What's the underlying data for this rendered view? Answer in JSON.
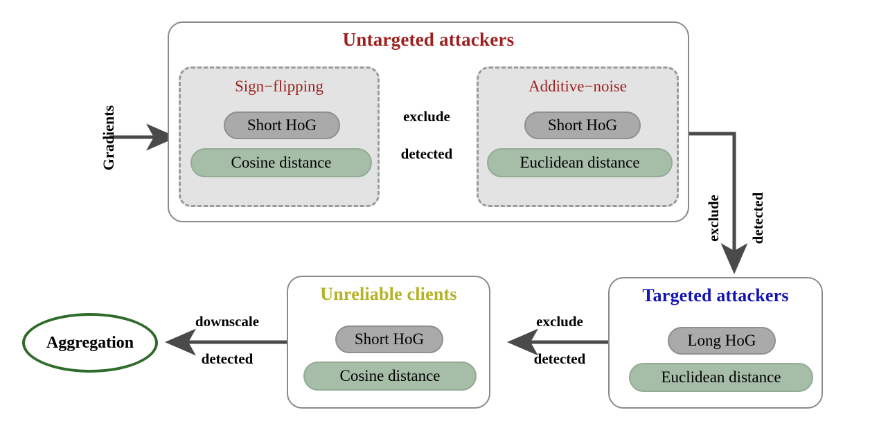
{
  "diagram": {
    "title_untargeted": "Untargeted attackers",
    "title_targeted": "Targeted attackers",
    "title_unreliable": "Unreliable clients",
    "aggregation_label": "Aggregation",
    "input_label": "Gradients",
    "colors": {
      "untargeted_red": "#9e1f1f",
      "targeted_blue": "#1414b4",
      "unreliable_olive": "#b5b225",
      "aggregation_green": "#2f6b2a",
      "pill_gray": "#aaaaaa",
      "pill_green": "#a6bda8",
      "subbox_fill": "#e3e3e3",
      "arrow_gray": "#4a4a4a",
      "box_border": "#8a8a8a"
    },
    "subboxes": {
      "sign_flipping": {
        "title": "Sign−flipping",
        "pill_hog": "Short HoG",
        "pill_distance": "Cosine distance"
      },
      "additive_noise": {
        "title": "Additive−noise",
        "pill_hog": "Short HoG",
        "pill_distance": "Euclidean distance"
      }
    },
    "targeted": {
      "pill_hog": "Long HoG",
      "pill_distance": "Euclidean distance"
    },
    "unreliable": {
      "pill_hog": "Short HoG",
      "pill_distance": "Cosine distance"
    },
    "arrows": {
      "a1_top": "exclude",
      "a1_bottom": "detected",
      "a2_top": "exclude",
      "a2_bottom": "detected",
      "a3_top": "exclude",
      "a3_bottom": "detected",
      "a4_top": "downscale",
      "a4_bottom": "detected"
    }
  }
}
